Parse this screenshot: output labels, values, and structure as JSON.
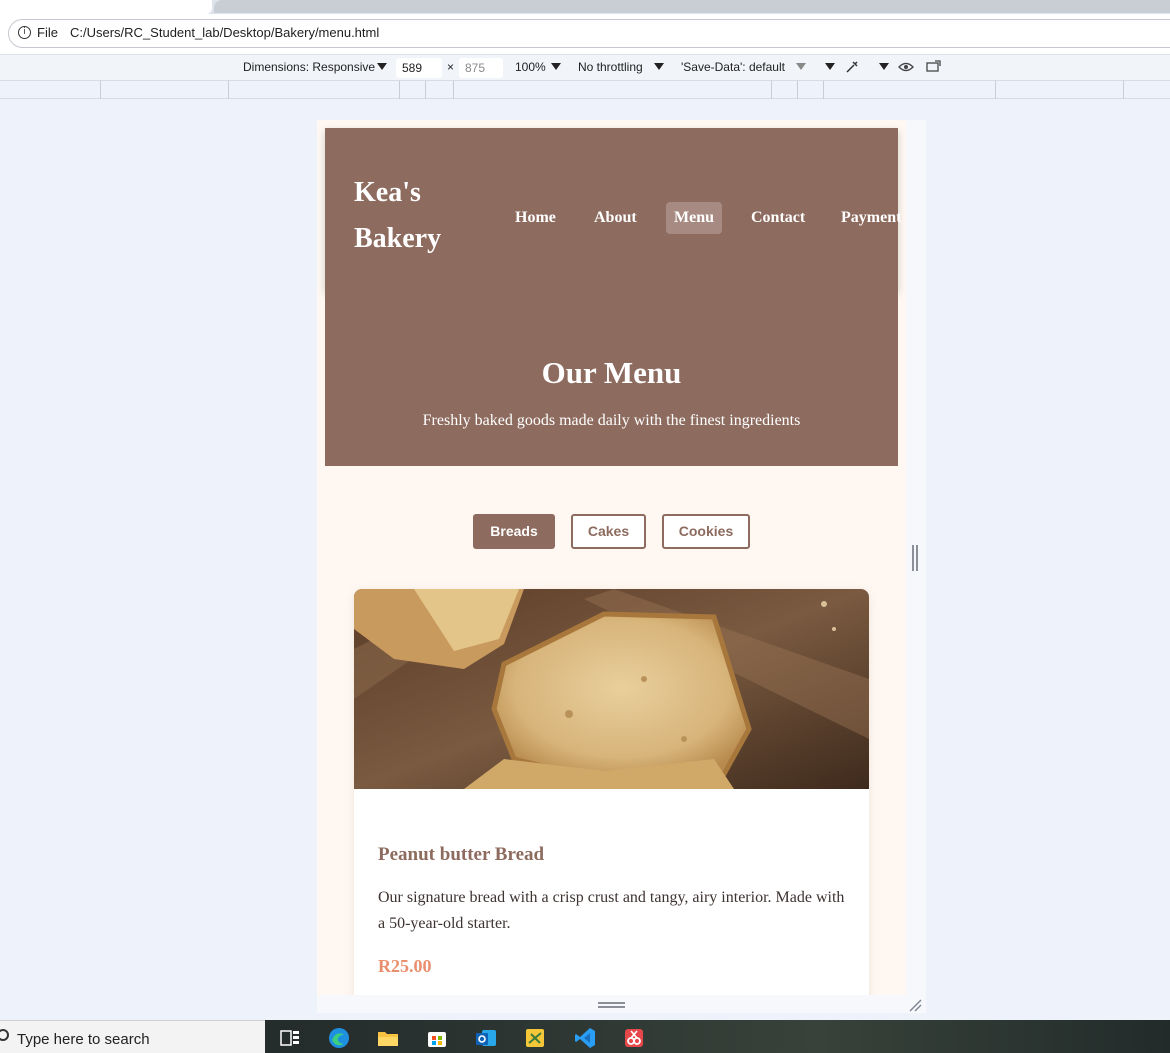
{
  "browser": {
    "file_label": "File",
    "url": "C:/Users/RC_Student_lab/Desktop/Bakery/menu.html"
  },
  "devtools": {
    "dimensions_label": "Dimensions: Responsive",
    "width_value": "589",
    "times": "×",
    "height_placeholder": "875",
    "zoom": "100%",
    "throttling": "No throttling",
    "save_data": "'Save-Data': default"
  },
  "site": {
    "logo": "Kea's Bakery",
    "nav": [
      "Home",
      "About",
      "Menu",
      "Contact",
      "Payment"
    ],
    "active_nav": "Menu",
    "hero_title": "Our Menu",
    "hero_subtitle": "Freshly baked goods made daily with the finest ingredients",
    "filters": [
      "Breads",
      "Cakes",
      "Cookies"
    ],
    "active_filter": "Breads",
    "item": {
      "title": "Peanut butter Bread",
      "description": "Our signature bread with a crisp crust and tangy, airy interior. Made with a 50-year-old starter.",
      "price": "R25.00"
    }
  },
  "colors": {
    "brand_brown": "#8d6b5f",
    "page_cream": "#fff8f2",
    "price_accent": "#e98f6d"
  },
  "taskbar": {
    "search_placeholder": "Type here to search",
    "icons": [
      "task-view-icon",
      "edge-icon",
      "file-explorer-icon",
      "store-icon",
      "outlook-icon",
      "sticky-app-icon",
      "vscode-icon",
      "snipping-tool-icon"
    ]
  }
}
